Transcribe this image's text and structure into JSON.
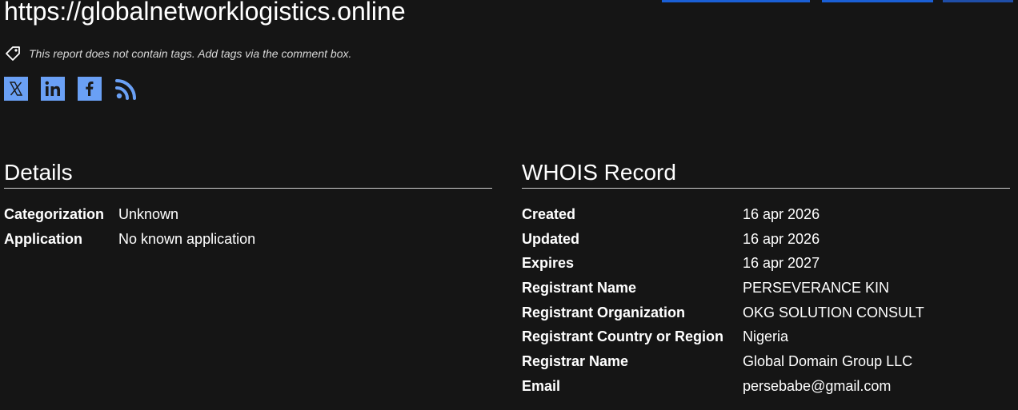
{
  "page": {
    "url_title": "https://globalnetworklogistics.online"
  },
  "tags": {
    "message": "This report does not contain tags. Add tags via the comment box."
  },
  "social": {
    "items": [
      "x-icon",
      "linkedin-icon",
      "facebook-icon",
      "rss-icon"
    ],
    "accent_color": "#6aa0f5"
  },
  "details": {
    "title": "Details",
    "rows": [
      {
        "key": "Categorization",
        "value": "Unknown"
      },
      {
        "key": "Application",
        "value": "No known application"
      }
    ]
  },
  "whois": {
    "title": "WHOIS Record",
    "rows": [
      {
        "key": "Created",
        "value": "16 apr 2026"
      },
      {
        "key": "Updated",
        "value": "16 apr 2026"
      },
      {
        "key": "Expires",
        "value": "16 apr 2027"
      },
      {
        "key": "Registrant Name",
        "value": "PERSEVERANCE KIN"
      },
      {
        "key": "Registrant Organization",
        "value": "OKG SOLUTION CONSULT"
      },
      {
        "key": "Registrant Country or Region",
        "value": "Nigeria"
      },
      {
        "key": "Registrar Name",
        "value": "Global Domain Group LLC"
      },
      {
        "key": "Email",
        "value": "persebabe@gmail.com"
      }
    ]
  },
  "colors": {
    "background": "#151515",
    "button_blue": "#1a5fd6"
  }
}
